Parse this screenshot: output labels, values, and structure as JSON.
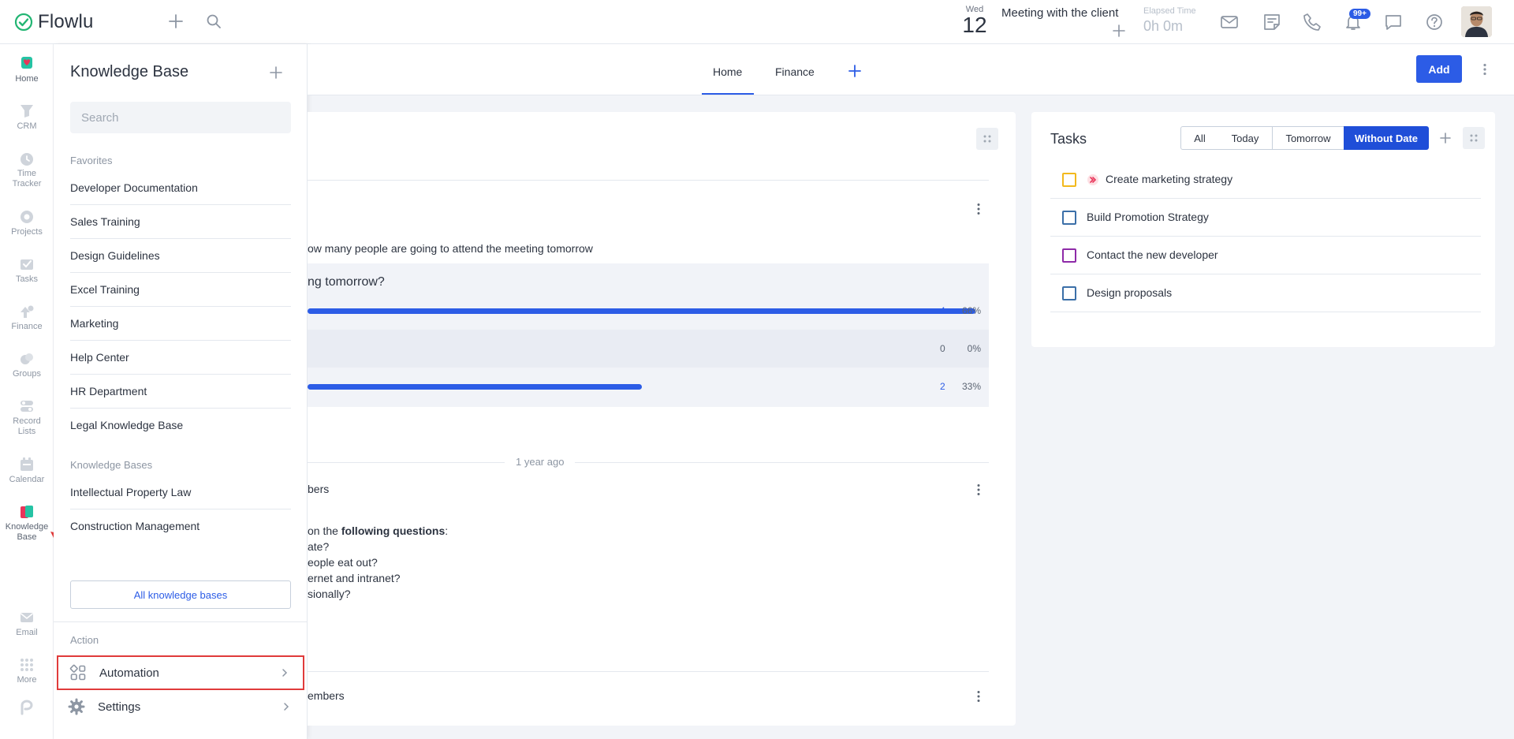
{
  "app": {
    "name": "Flowlu"
  },
  "topbar": {
    "date_dow": "Wed",
    "date_day": "12",
    "meeting_title": "Meeting with the client",
    "elapsed_label": "Elapsed Time",
    "elapsed_value": "0h 0m",
    "notification_badge": "99+"
  },
  "rail": {
    "items": [
      {
        "label": "Home",
        "icon": "home-icon"
      },
      {
        "label": "CRM",
        "icon": "crm-icon"
      },
      {
        "label": "Time Tracker",
        "icon": "time-tracker-icon"
      },
      {
        "label": "Projects",
        "icon": "projects-icon"
      },
      {
        "label": "Tasks",
        "icon": "tasks-icon"
      },
      {
        "label": "Finance",
        "icon": "finance-icon"
      },
      {
        "label": "Groups",
        "icon": "groups-icon"
      },
      {
        "label": "Record Lists",
        "icon": "record-lists-icon"
      },
      {
        "label": "Calendar",
        "icon": "calendar-icon"
      },
      {
        "label": "Knowledge Base",
        "icon": "knowledge-base-icon"
      },
      {
        "label": "Email",
        "icon": "email-icon"
      },
      {
        "label": "More",
        "icon": "more-grid-icon"
      }
    ]
  },
  "kb": {
    "title": "Knowledge Base",
    "search_placeholder": "Search",
    "favorites_label": "Favorites",
    "favorites": [
      "Developer Documentation",
      "Sales Training",
      "Design Guidelines",
      "Excel Training",
      "Marketing",
      "Help Center",
      "HR Department",
      "Legal Knowledge Base"
    ],
    "bases_label": "Knowledge Bases",
    "bases": [
      "Intellectual Property Law",
      "Construction Management"
    ],
    "all_button": "All knowledge bases",
    "action_label": "Action",
    "actions": [
      {
        "label": "Automation",
        "icon": "automation-icon"
      },
      {
        "label": "Settings",
        "icon": "gear-icon"
      }
    ]
  },
  "main": {
    "tabs": [
      {
        "label": "Home"
      },
      {
        "label": "Finance"
      }
    ],
    "add_button": "Add",
    "feed": {
      "post1_text": "ow many people are going to attend the meeting tomorrow",
      "poll_question": "ng tomorrow?",
      "poll_rows": [
        {
          "count": "4",
          "pct": "66%",
          "fraction": 0.66
        },
        {
          "count": "0",
          "pct": "0%",
          "fraction": 0
        },
        {
          "count": "2",
          "pct": "33%",
          "fraction": 0.33
        }
      ],
      "time_ago": "1 year ago",
      "post2_title": "bers",
      "post2_intro_prefix": "on the ",
      "post2_intro_bold": "following questions",
      "post2_intro_suffix": ":",
      "post2_lines": [
        "ate?",
        "eople eat out?",
        "ernet and intranet?",
        "sionally?"
      ],
      "post3_title": "embers"
    }
  },
  "tasks": {
    "title": "Tasks",
    "filters": [
      "All",
      "Today",
      "Tomorrow",
      "Without Date"
    ],
    "active_filter": "Without Date",
    "items": [
      {
        "text": "Create marketing strategy",
        "color": "#f2b91d",
        "priority": true
      },
      {
        "text": "Build Promotion Strategy",
        "color": "#3b6fa8",
        "priority": false
      },
      {
        "text": "Contact the new developer",
        "color": "#8e2aa8",
        "priority": false
      },
      {
        "text": "Design proposals",
        "color": "#3b6fa8",
        "priority": false
      }
    ]
  },
  "colors": {
    "accent": "#2c5ce6",
    "highlight": "#e03b3b"
  }
}
